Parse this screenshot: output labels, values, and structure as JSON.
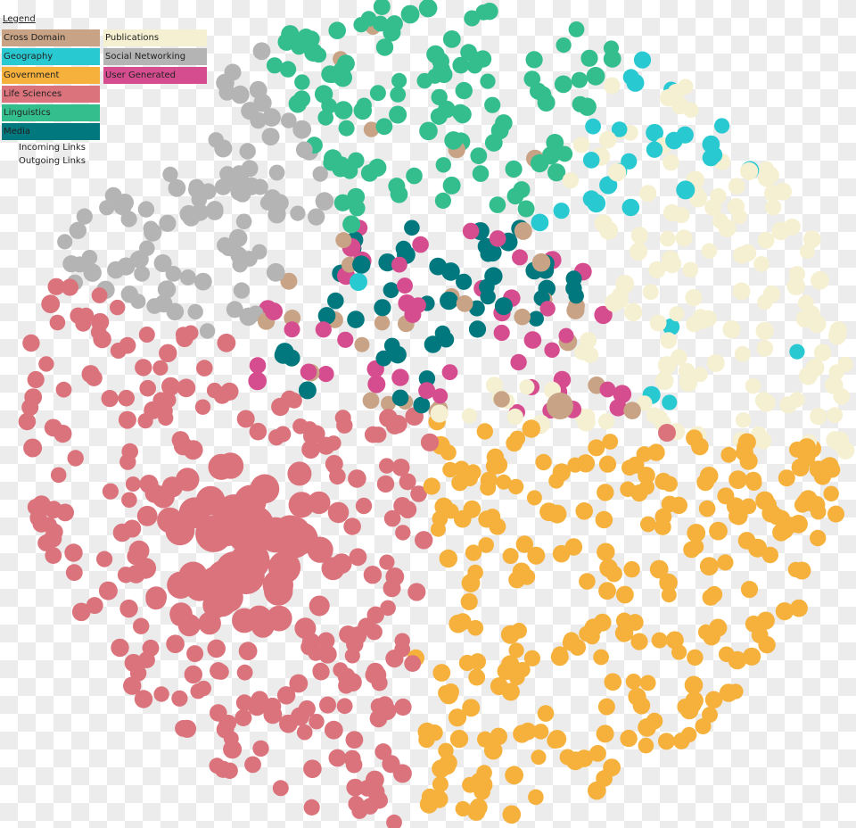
{
  "legend": {
    "title": "Legend",
    "categories": [
      {
        "label": "Cross Domain",
        "color": "#c8a385"
      },
      {
        "label": "Geography",
        "color": "#29c9d1"
      },
      {
        "label": "Government",
        "color": "#f5b13c"
      },
      {
        "label": "Life Sciences",
        "color": "#db737c"
      },
      {
        "label": "Linguistics",
        "color": "#34be8e"
      },
      {
        "label": "Media",
        "color": "#00787d"
      },
      {
        "label": "Publications",
        "color": "#f5f0d2"
      },
      {
        "label": "Social Networking",
        "color": "#b4b4b4"
      },
      {
        "label": "User Generated",
        "color": "#d64d8f"
      }
    ],
    "incoming_links": "Incoming Links",
    "outgoing_links": "Outgoing Links"
  }
}
